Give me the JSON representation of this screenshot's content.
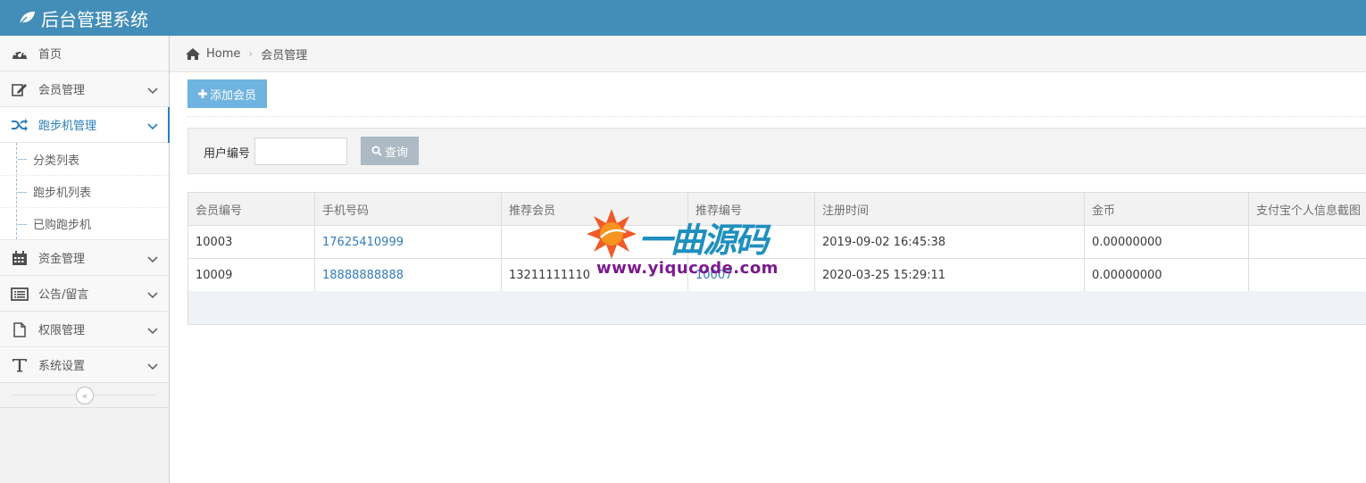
{
  "app": {
    "title": "后台管理系统"
  },
  "sidebar": {
    "items": [
      {
        "label": "首页",
        "icon": "dashboard-icon"
      },
      {
        "label": "会员管理",
        "icon": "edit-icon"
      },
      {
        "label": "跑步机管理",
        "icon": "random-icon",
        "active": true,
        "children": [
          {
            "label": "分类列表"
          },
          {
            "label": "跑步机列表"
          },
          {
            "label": "已购跑步机"
          }
        ]
      },
      {
        "label": "资金管理",
        "icon": "calendar-icon"
      },
      {
        "label": "公告/留言",
        "icon": "list-alt-icon"
      },
      {
        "label": "权限管理",
        "icon": "file-icon"
      },
      {
        "label": "系统设置",
        "icon": "text-height-icon"
      }
    ],
    "collapse_icon": "double-angle-left-icon"
  },
  "breadcrumb": {
    "home": "Home",
    "current": "会员管理"
  },
  "toolbar": {
    "add_label": "添加会员"
  },
  "search": {
    "label": "用户编号",
    "value": "",
    "button_label": "查询"
  },
  "table": {
    "headers": [
      "会员编号",
      "手机号码",
      "推荐会员",
      "推荐编号",
      "注册时间",
      "金币",
      "支付宝个人信息截图"
    ],
    "rows": [
      [
        "10003",
        "17625410999",
        "",
        "",
        "2019-09-02 16:45:38",
        "0.00000000",
        ""
      ],
      [
        "10009",
        "18888888888",
        "13211111110",
        "10007",
        "2020-03-25 15:29:11",
        "0.00000000",
        ""
      ]
    ]
  },
  "watermark": {
    "text": "一曲源码",
    "url": "www.yiqucode.com"
  },
  "colors": {
    "header": "#438eb9",
    "link": "#337ab7",
    "add_button": "#6fb3e0",
    "query_button": "#abbac3"
  }
}
